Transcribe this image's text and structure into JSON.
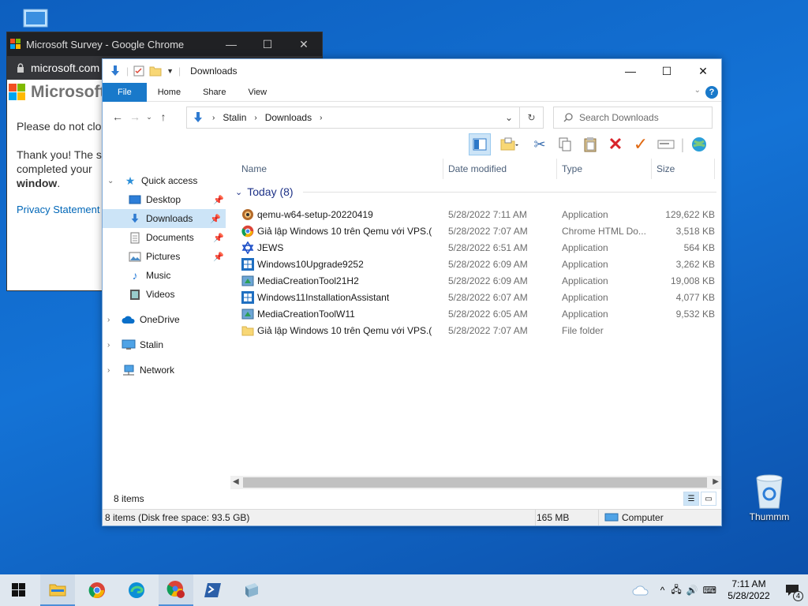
{
  "chrome_window": {
    "title": "Microsoft Survey - Google Chrome",
    "url": "microsoft.com",
    "brand": "Microsoft",
    "msg1": "Please do not clo",
    "msg2_line1": "Thank you! The s",
    "msg2_line2": "completed your",
    "msg2_bold": "window",
    "msg2_end": ".",
    "privacy": "Privacy Statement"
  },
  "explorer": {
    "title": "Downloads",
    "ribbon_tabs": [
      "File",
      "Home",
      "Share",
      "View"
    ],
    "breadcrumb": [
      "Stalin",
      "Downloads"
    ],
    "search_placeholder": "Search Downloads",
    "nav": {
      "quick_access": "Quick access",
      "items": [
        "Desktop",
        "Downloads",
        "Documents",
        "Pictures",
        "Music",
        "Videos"
      ],
      "onedrive": "OneDrive",
      "thispc": "Stalin",
      "network": "Network"
    },
    "columns": [
      "Name",
      "Date modified",
      "Type",
      "Size"
    ],
    "group": "Today (8)",
    "files": [
      {
        "name": "qemu-w64-setup-20220419",
        "date": "5/28/2022 7:11 AM",
        "type": "Application",
        "size": "129,622 KB",
        "icon": "qemu-icon"
      },
      {
        "name": "Giả lập Windows 10 trên Qemu với VPS.(...",
        "date": "5/28/2022 7:07 AM",
        "type": "Chrome HTML Do...",
        "size": "3,518 KB",
        "icon": "chrome-icon"
      },
      {
        "name": "JEWS",
        "date": "5/28/2022 6:51 AM",
        "type": "Application",
        "size": "564 KB",
        "icon": "star-icon"
      },
      {
        "name": "Windows10Upgrade9252",
        "date": "5/28/2022 6:09 AM",
        "type": "Application",
        "size": "3,262 KB",
        "icon": "windows-icon"
      },
      {
        "name": "MediaCreationTool21H2",
        "date": "5/28/2022 6:09 AM",
        "type": "Application",
        "size": "19,008 KB",
        "icon": "media-tool-icon"
      },
      {
        "name": "Windows11InstallationAssistant",
        "date": "5/28/2022 6:07 AM",
        "type": "Application",
        "size": "4,077 KB",
        "icon": "windows-icon"
      },
      {
        "name": "MediaCreationToolW11",
        "date": "5/28/2022 6:05 AM",
        "type": "Application",
        "size": "9,532 KB",
        "icon": "media-tool-icon"
      },
      {
        "name": "Giả lập Windows 10 trên Qemu với VPS.(...",
        "date": "5/28/2022 7:07 AM",
        "type": "File folder",
        "size": "",
        "icon": "folder-icon"
      }
    ],
    "item_count": "8 items",
    "status_left": "8 items (Disk free space: 93.5 GB)",
    "status_size": "165 MB",
    "status_computer": "Computer"
  },
  "desktop": {
    "recycle_label": "Thummm"
  },
  "taskbar": {
    "time": "7:11 AM",
    "date": "5/28/2022",
    "notification_count": "4"
  },
  "colors": {
    "accent": "#1979ca",
    "selection": "#cce4f7",
    "group_header": "#1e3287"
  }
}
